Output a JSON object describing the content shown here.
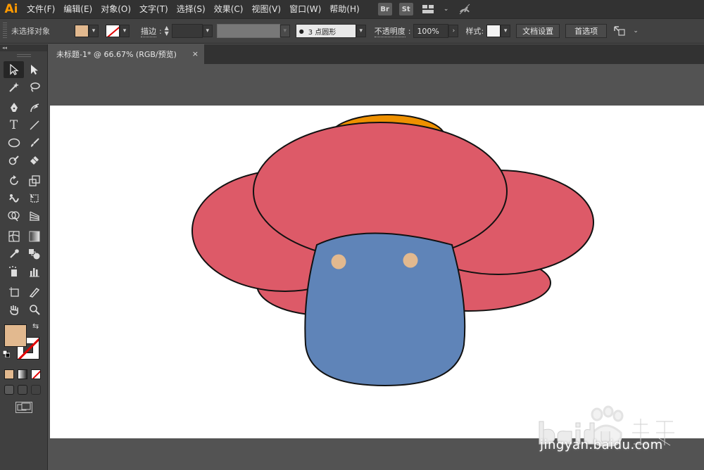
{
  "app": {
    "logo": "Ai"
  },
  "menu": {
    "items": [
      "文件(F)",
      "编辑(E)",
      "对象(O)",
      "文字(T)",
      "选择(S)",
      "效果(C)",
      "视图(V)",
      "窗口(W)",
      "帮助(H)"
    ],
    "bridge_label": "Br",
    "stock_label": "St"
  },
  "control": {
    "selection_label": "未选择对象",
    "stroke_label": "描边",
    "brush_label": "3 点圆形",
    "opacity_label": "不透明度",
    "opacity_value": "100%",
    "style_label": "样式",
    "doc_setup_label": "文档设置",
    "prefs_label": "首选项",
    "fill_color": "#e2b98f"
  },
  "document": {
    "tab_title": "未标题-1* @ 66.67% (RGB/预览)",
    "close_glyph": "×"
  },
  "artwork": {
    "petal_color": "#dd5a68",
    "body_color": "#5f84b8",
    "eye_color": "#e2b98f",
    "top_color": "#ee9000"
  },
  "watermark": {
    "url": "jingyan.baidu.com"
  }
}
